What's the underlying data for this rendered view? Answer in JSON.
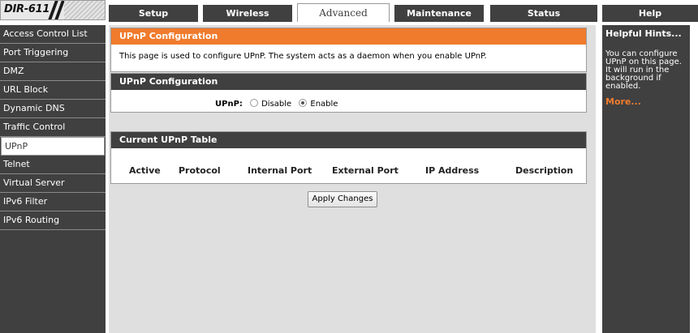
{
  "header": {
    "logo_text": "DIR-611",
    "tabs": [
      {
        "label": "Setup"
      },
      {
        "label": "Wireless"
      },
      {
        "label": "Advanced"
      },
      {
        "label": "Maintenance"
      },
      {
        "label": "Status"
      },
      {
        "label": "Help"
      }
    ],
    "active_tab": "Advanced"
  },
  "sidebar": {
    "items": [
      {
        "label": "Access Control List"
      },
      {
        "label": "Port Triggering"
      },
      {
        "label": "DMZ"
      },
      {
        "label": "URL Block"
      },
      {
        "label": "Dynamic DNS"
      },
      {
        "label": "Traffic Control"
      },
      {
        "label": "UPnP"
      },
      {
        "label": "Telnet"
      },
      {
        "label": "Virtual Server"
      },
      {
        "label": "IPv6 Filter"
      },
      {
        "label": "IPv6 Routing"
      }
    ],
    "active_item": "UPnP"
  },
  "intro": {
    "title": "UPnP Configuration",
    "text": "This page is used to configure UPnP. The system acts as a daemon when you enable UPnP."
  },
  "config": {
    "title": "UPnP Configuration",
    "field_label": "UPnP:",
    "options": [
      {
        "label": "Disable",
        "checked": false
      },
      {
        "label": "Enable",
        "checked": true
      }
    ]
  },
  "table": {
    "title": "Current UPnP Table",
    "columns": [
      "Active",
      "Protocol",
      "Internal Port",
      "External Port",
      "IP Address",
      "Description"
    ],
    "rows": []
  },
  "actions": {
    "apply_label": "Apply Changes"
  },
  "hints": {
    "title": "Helpful Hints...",
    "text": "You can configure UPnP on this page. It will run in the background if enabled.",
    "more": "More..."
  },
  "colors": {
    "accent_orange": "#f07b2d",
    "dark_gray": "#404040",
    "content_bg": "#dfdfdf"
  }
}
